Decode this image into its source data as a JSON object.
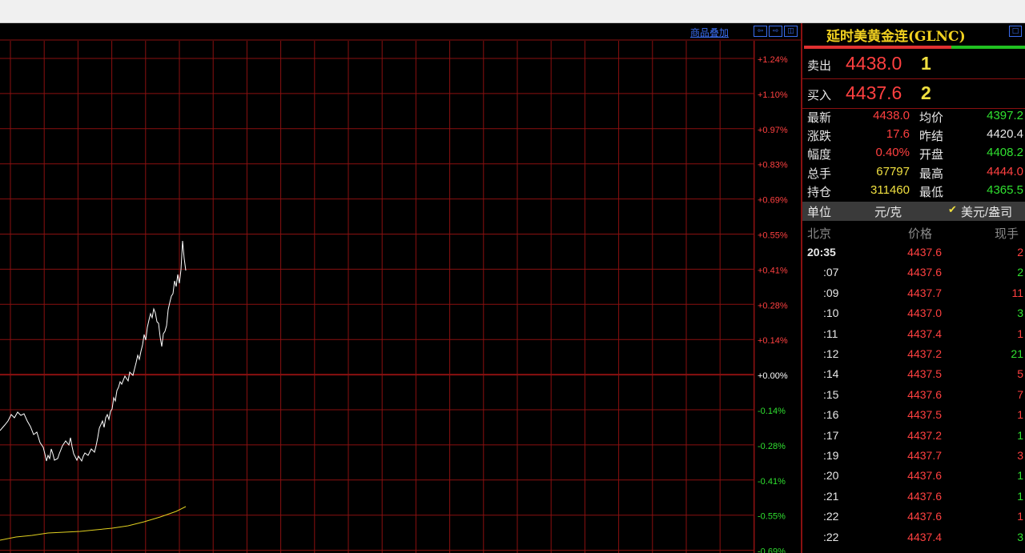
{
  "chart": {
    "overlay_link": "商品叠加",
    "tool_icons": [
      "scroll-left-icon",
      "scroll-right-icon",
      "layout-icon"
    ],
    "axis_labels": [
      {
        "text": "+1.24%",
        "color": "#ff4040"
      },
      {
        "text": "+1.10%",
        "color": "#ff4040"
      },
      {
        "text": "+0.97%",
        "color": "#ff4040"
      },
      {
        "text": "+0.83%",
        "color": "#ff4040"
      },
      {
        "text": "+0.69%",
        "color": "#ff4040"
      },
      {
        "text": "+0.55%",
        "color": "#ff4040"
      },
      {
        "text": "+0.41%",
        "color": "#ff4040"
      },
      {
        "text": "+0.28%",
        "color": "#ff4040"
      },
      {
        "text": "+0.14%",
        "color": "#ff4040"
      },
      {
        "text": "+0.00%",
        "color": "#ffffff"
      },
      {
        "text": "-0.14%",
        "color": "#30e030"
      },
      {
        "text": "-0.28%",
        "color": "#30e030"
      },
      {
        "text": "-0.41%",
        "color": "#30e030"
      },
      {
        "text": "-0.55%",
        "color": "#30e030"
      },
      {
        "text": "-0.69%",
        "color": "#30e030"
      }
    ]
  },
  "quote": {
    "title": "延时美黄金连(GLNC)",
    "sell": {
      "label": "卖出",
      "price": "4438.0",
      "volume": "1"
    },
    "buy": {
      "label": "买入",
      "price": "4437.6",
      "volume": "2"
    },
    "stats": [
      {
        "label": "最新",
        "value": "4438.0",
        "color": "red",
        "label2": "均价",
        "value2": "4397.2",
        "color2": "green"
      },
      {
        "label": "涨跌",
        "value": "17.6",
        "color": "red",
        "label2": "昨结",
        "value2": "4420.4",
        "color2": "white"
      },
      {
        "label": "幅度",
        "value": "0.40%",
        "color": "red",
        "label2": "开盘",
        "value2": "4408.2",
        "color2": "green"
      },
      {
        "label": "总手",
        "value": "67797",
        "color": "yellow",
        "label2": "最高",
        "value2": "4444.0",
        "color2": "red"
      },
      {
        "label": "持仓",
        "value": "311460",
        "color": "yellow",
        "label2": "最低",
        "value2": "4365.5",
        "color2": "green"
      }
    ],
    "unit": {
      "label": "单位",
      "value": "元/克",
      "check": "✔",
      "alt": "美元/盎司"
    },
    "ticks_header": {
      "time": "北京",
      "price": "价格",
      "volume": "现手"
    },
    "ticks": [
      {
        "time": "20:35",
        "price": "4437.6",
        "volume": "2",
        "vol_color": "red"
      },
      {
        "time": ":07",
        "price": "4437.6",
        "volume": "2",
        "vol_color": "green"
      },
      {
        "time": ":09",
        "price": "4437.7",
        "volume": "11",
        "vol_color": "red"
      },
      {
        "time": ":10",
        "price": "4437.0",
        "volume": "3",
        "vol_color": "green"
      },
      {
        "time": ":11",
        "price": "4437.4",
        "volume": "1",
        "vol_color": "red"
      },
      {
        "time": ":12",
        "price": "4437.2",
        "volume": "21",
        "vol_color": "green"
      },
      {
        "time": ":14",
        "price": "4437.5",
        "volume": "5",
        "vol_color": "red"
      },
      {
        "time": ":15",
        "price": "4437.6",
        "volume": "7",
        "vol_color": "red"
      },
      {
        "time": ":16",
        "price": "4437.5",
        "volume": "1",
        "vol_color": "red"
      },
      {
        "time": ":17",
        "price": "4437.2",
        "volume": "1",
        "vol_color": "green"
      },
      {
        "time": ":19",
        "price": "4437.7",
        "volume": "3",
        "vol_color": "red"
      },
      {
        "time": ":20",
        "price": "4437.6",
        "volume": "1",
        "vol_color": "green"
      },
      {
        "time": ":21",
        "price": "4437.6",
        "volume": "1",
        "vol_color": "green"
      },
      {
        "time": ":22",
        "price": "4437.6",
        "volume": "1",
        "vol_color": "red"
      },
      {
        "time": ":22",
        "price": "4437.4",
        "volume": "3",
        "vol_color": "green"
      }
    ]
  },
  "colors": {
    "up": "#ff4040",
    "down": "#30e030",
    "grid": "#8a1010",
    "price_line": "#ffffff",
    "avg_line": "#e0d020",
    "title": "#f0d020"
  }
}
